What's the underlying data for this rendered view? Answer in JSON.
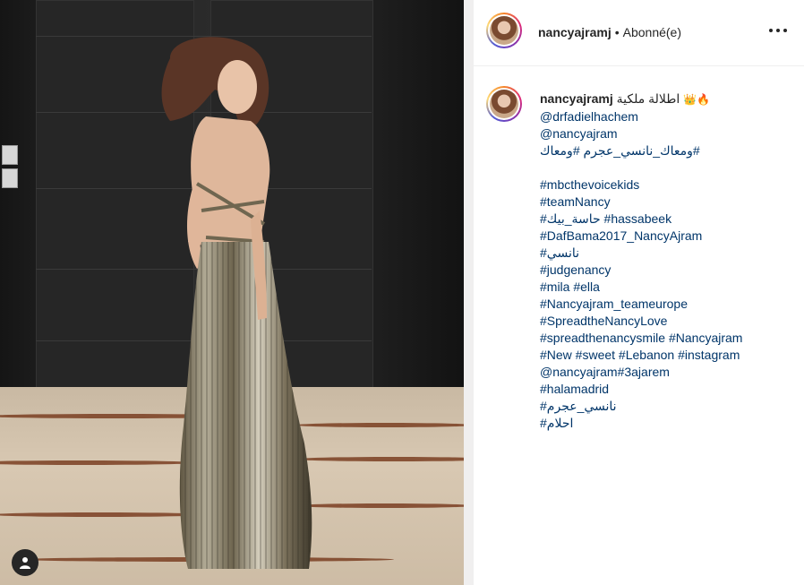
{
  "header": {
    "username": "nancyajramj",
    "separator": "•",
    "follow_state": "Abonné(e)"
  },
  "caption": {
    "username": "nancyajramj",
    "first_text": "اطلالة ملكية",
    "emojis": "👑🔥",
    "lines": [
      "@drfadielhachem",
      "@nancyajram",
      "#ومعاك_نانسي_عجرم #ومعاك",
      "",
      "#mbcthevoicekids",
      "#teamNancy",
      "#حاسة_بيك #hassabeek",
      "#DafBama2017_NancyAjram",
      "#نانسي",
      "#judgenancy",
      "#mila #ella",
      "#Nancyajram_teameurope",
      "#SpreadtheNancyLove",
      "#spreadthenancysmile #Nancyajram",
      "#New #sweet #Lebanon #instagram",
      "@nancyajram#3ajarem",
      "#halamadrid",
      "#نانسي_عجرم",
      "#احلام"
    ]
  },
  "colors": {
    "text": "#262626",
    "link": "#003569",
    "border": "#efefef"
  },
  "icons": {
    "more": "more-options-icon",
    "user": "user-tag-icon"
  }
}
